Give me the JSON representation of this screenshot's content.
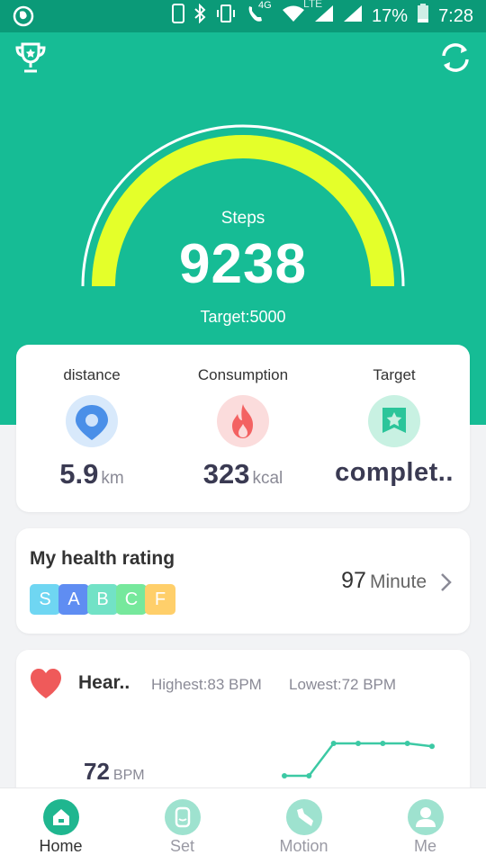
{
  "status_bar": {
    "network_label": "4G",
    "lte_label": "LTE",
    "battery_percent": "17%",
    "time": "7:28"
  },
  "hero": {
    "steps_label": "Steps",
    "steps_value": "9238",
    "target_text": "Target:5000",
    "gauge_fraction": 1.0,
    "colors": {
      "background": "#16bc95",
      "gauge": "#e4ff2a"
    }
  },
  "stats": [
    {
      "label": "distance",
      "value": "5.9",
      "unit": "km",
      "icon": "location-pin-icon"
    },
    {
      "label": "Consumption",
      "value": "323",
      "unit": "kcal",
      "icon": "flame-icon"
    },
    {
      "label": "Target",
      "value": "complet..",
      "unit": "",
      "icon": "target-star-badge-icon"
    }
  ],
  "health_rating": {
    "title": "My health rating",
    "grades": [
      "S",
      "A",
      "B",
      "C",
      "F"
    ],
    "grade_colors": [
      "#6fd6f2",
      "#5f8df2",
      "#72e2c6",
      "#76e89c",
      "#ffcf6a"
    ],
    "value": "97",
    "unit": "Minute"
  },
  "heart": {
    "title": "Hear..",
    "highest": "Highest:83  BPM",
    "lowest": "Lowest:72  BPM",
    "value": "72",
    "unit": "BPM",
    "trend": [
      72,
      72,
      83,
      83,
      83,
      83,
      82
    ]
  },
  "nav": [
    {
      "label": "Home",
      "active": true,
      "icon": "home-icon"
    },
    {
      "label": "Set",
      "active": false,
      "icon": "watch-icon"
    },
    {
      "label": "Motion",
      "active": false,
      "icon": "shoe-icon"
    },
    {
      "label": "Me",
      "active": false,
      "icon": "person-icon"
    }
  ]
}
